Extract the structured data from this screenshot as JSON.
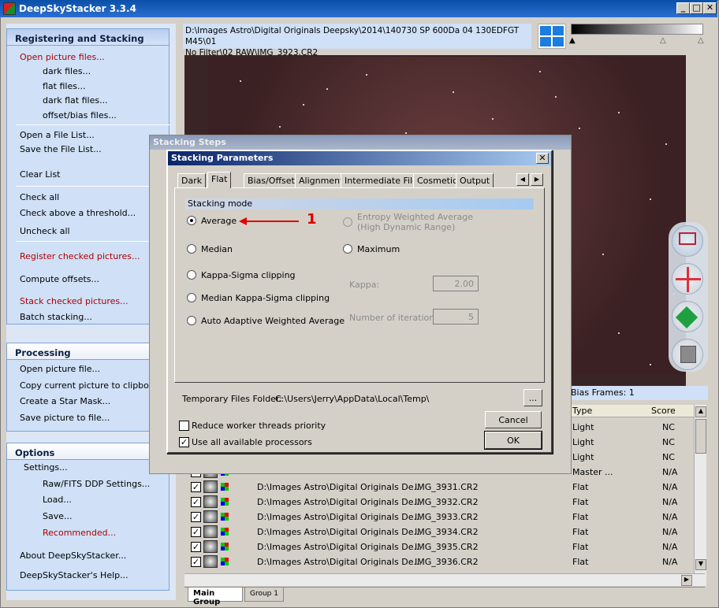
{
  "window": {
    "title": "DeepSkyStacker 3.3.4",
    "minimize": "_",
    "maximize": "□",
    "close": "✕"
  },
  "left_panel": {
    "registering": {
      "heading": "Registering and Stacking",
      "items": [
        "Open picture files...",
        "dark files...",
        "flat files...",
        "dark flat files...",
        "offset/bias files...",
        "Open a File List...",
        "Save the File List...",
        "Clear List",
        "Check all",
        "Check above a threshold...",
        "Uncheck all",
        "Register checked pictures...",
        "Compute offsets...",
        "Stack checked pictures...",
        "Batch stacking..."
      ]
    },
    "processing": {
      "heading": "Processing",
      "items": [
        "Open picture file...",
        "Copy current picture to clipboard",
        "Create a Star Mask...",
        "Save picture to file..."
      ]
    },
    "options": {
      "heading": "Options",
      "items": [
        "Settings...",
        "Raw/FITS DDP Settings...",
        "Load...",
        "Save...",
        "Recommended...",
        "About DeepSkyStacker...",
        "DeepSkyStacker's Help..."
      ]
    }
  },
  "path": {
    "line1": "D:\\Images Astro\\Digital Originals Deepsky\\2014\\140730 SP 600Da 04 130EDFGT M45\\01",
    "line2": "No Filter\\02 RAW\\IMG_3923.CR2"
  },
  "bias_frames": "Bias Frames: 1",
  "table": {
    "headers": {
      "type": "Type",
      "score": "Score"
    },
    "rows": [
      {
        "path": "",
        "file": "",
        "type": "Light",
        "score": "NC"
      },
      {
        "path": "",
        "file": "",
        "type": "Light",
        "score": "NC"
      },
      {
        "path": "",
        "file": "",
        "type": "Light",
        "score": "NC"
      },
      {
        "path": "",
        "file": "",
        "type": "Master ...",
        "score": "N/A"
      },
      {
        "path": "D:\\Images Astro\\Digital Originals De...",
        "file": "IMG_3931.CR2",
        "type": "Flat",
        "score": "N/A"
      },
      {
        "path": "D:\\Images Astro\\Digital Originals De...",
        "file": "IMG_3932.CR2",
        "type": "Flat",
        "score": "N/A"
      },
      {
        "path": "D:\\Images Astro\\Digital Originals De...",
        "file": "IMG_3933.CR2",
        "type": "Flat",
        "score": "N/A"
      },
      {
        "path": "D:\\Images Astro\\Digital Originals De...",
        "file": "IMG_3934.CR2",
        "type": "Flat",
        "score": "N/A"
      },
      {
        "path": "D:\\Images Astro\\Digital Originals De...",
        "file": "IMG_3935.CR2",
        "type": "Flat",
        "score": "N/A"
      },
      {
        "path": "D:\\Images Astro\\Digital Originals De...",
        "file": "IMG_3936.CR2",
        "type": "Flat",
        "score": "N/A"
      }
    ]
  },
  "group_tabs": [
    "Main Group",
    "Group 1"
  ],
  "stacking_steps": {
    "title": "Stacking Steps"
  },
  "dialog": {
    "title": "Stacking Parameters",
    "tabs": [
      "Dark",
      "Flat",
      "Bias/Offset",
      "Alignment",
      "Intermediate Files",
      "Cosmetic",
      "Output"
    ],
    "selected_tab": "Flat",
    "section": "Stacking mode",
    "modes": {
      "average": "Average",
      "entropy_1": "Entropy Weighted Average",
      "entropy_2": "(High Dynamic Range)",
      "median": "Median",
      "maximum": "Maximum",
      "kappa_sigma": "Kappa-Sigma clipping",
      "median_kappa_sigma": "Median Kappa-Sigma clipping",
      "auto_adaptive": "Auto Adaptive Weighted Average"
    },
    "kappa_label": "Kappa:",
    "kappa_value": "2.00",
    "iterations_label": "Number of iterations:",
    "iterations_value": "5",
    "temp_label": "Temporary Files Folder:",
    "temp_path": "C:\\Users\\Jerry\\AppData\\Local\\Temp\\",
    "browse": "...",
    "reduce_threads": "Reduce worker threads priority",
    "use_all_processors": "Use all available processors",
    "cancel": "Cancel",
    "ok": "OK"
  },
  "annotation": {
    "number": "1",
    "color": "#e00000"
  },
  "colors": {
    "title_bar": "#0a4fa8",
    "panel": "#cfe0f7",
    "link_red": "#b00000"
  }
}
